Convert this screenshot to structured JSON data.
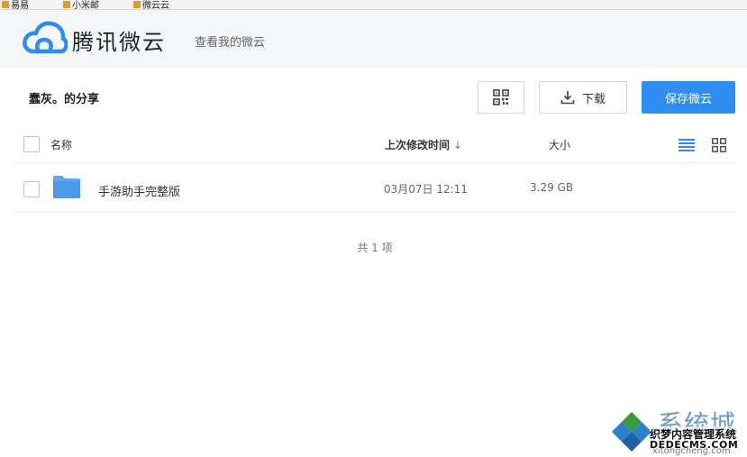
{
  "browser": {
    "bookmarks": [
      "易易",
      "小米邮",
      "微云云"
    ]
  },
  "header": {
    "brand": "腾讯微云",
    "view_link": "查看我的微云"
  },
  "share": {
    "title": "蠢灰。的分享"
  },
  "toolbar": {
    "qr_icon": "qr-code-icon",
    "download_label": "下载",
    "save_label": "保存微云"
  },
  "table": {
    "headers": {
      "name": "名称",
      "time": "上次修改时间",
      "size": "大小"
    },
    "rows": [
      {
        "name": "手游助手完整版",
        "time": "03月07日 12:11",
        "size": "3.29 GB",
        "icon": "folder-icon"
      }
    ]
  },
  "footer": {
    "count": "共 1 项"
  },
  "watermark": {
    "big": "系统城",
    "line1": "织梦内容管理系统",
    "line2": "DEDECMS.COM",
    "line3": "xitongcheng.com"
  },
  "colors": {
    "accent": "#2f8cf0",
    "header_bg": "#f4f6f8",
    "folder": "#5aa7ee"
  }
}
